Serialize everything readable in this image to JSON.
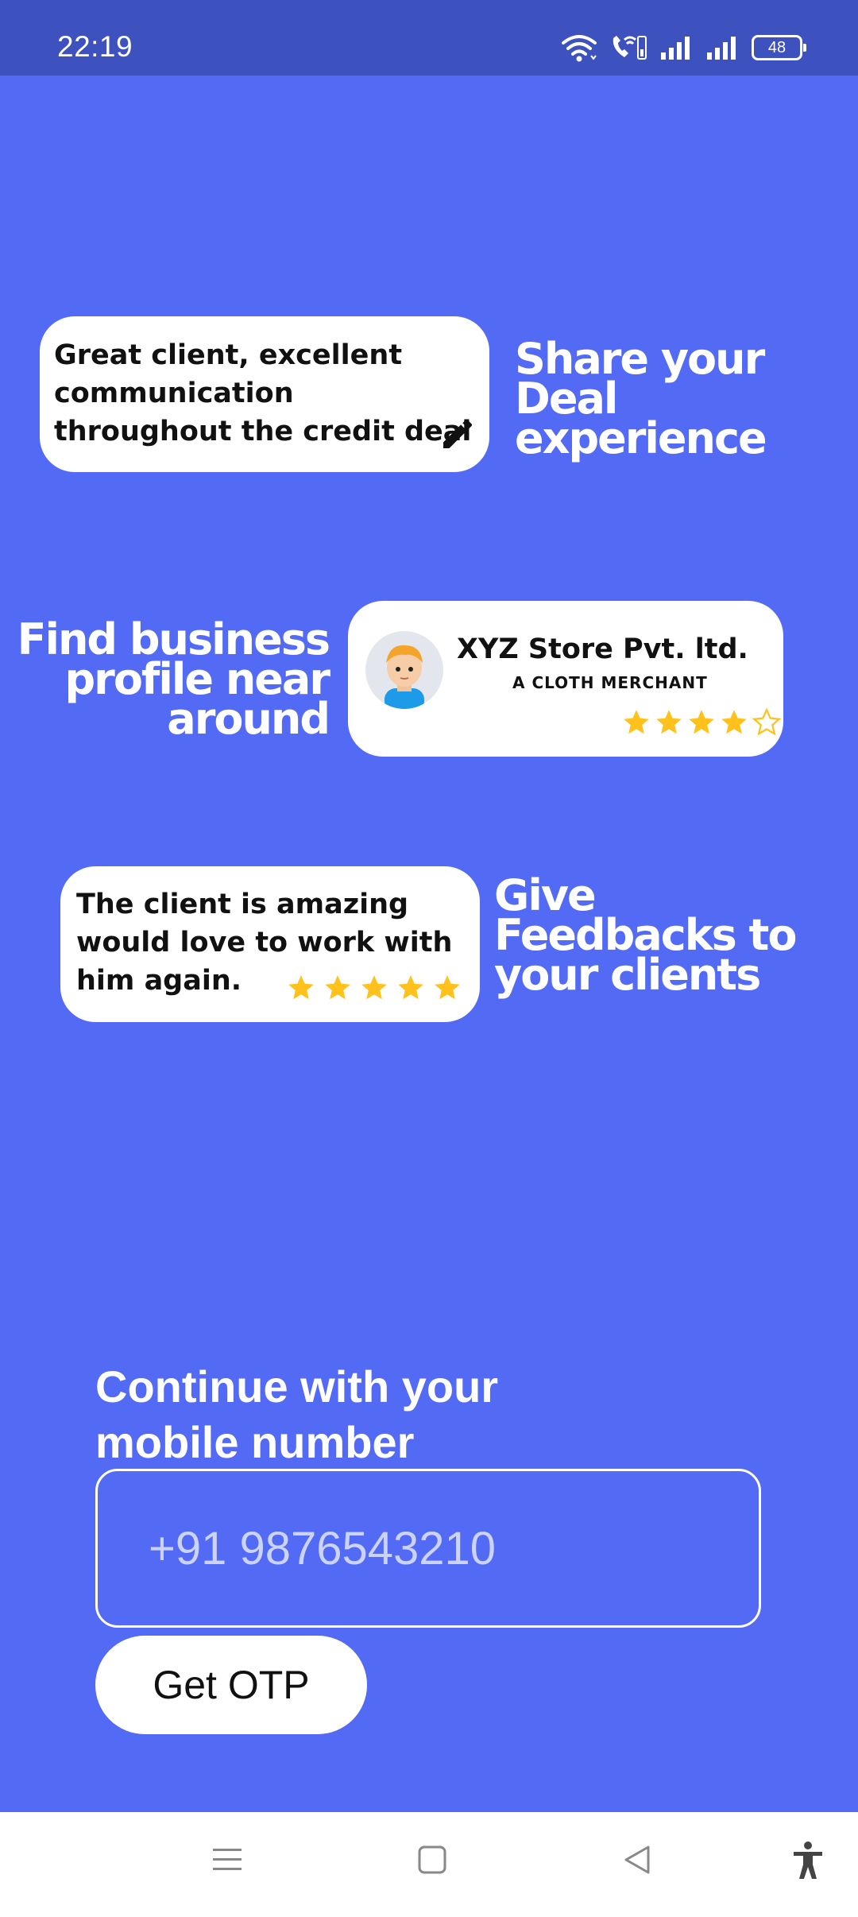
{
  "status_bar": {
    "time": "22:19",
    "battery": "48",
    "icons": [
      "wifi-icon",
      "wifi-call-icon",
      "signal-icon-1",
      "signal-icon-2",
      "battery-icon"
    ]
  },
  "cards": {
    "deal": {
      "text_lines": [
        "Great client, excellent",
        "communication",
        "throughout the credit deal"
      ],
      "icon": "pencil-icon"
    },
    "business": {
      "store_name": "XYZ Store Pvt. ltd.",
      "store_subtitle": "A CLOTH MERCHANT",
      "rating": 4,
      "rating_max": 5
    },
    "feedback": {
      "text_lines": [
        "The client is amazing",
        "would love to work with",
        "him again."
      ],
      "rating": 5,
      "rating_max": 5
    }
  },
  "headlines": {
    "share": [
      "Share your",
      "Deal",
      "experience"
    ],
    "find": [
      "Find business",
      "profile near",
      "around"
    ],
    "give": [
      "Give",
      "Feedbacks to",
      "your clients"
    ]
  },
  "login": {
    "label_lines": [
      "Continue with your",
      "mobile number"
    ],
    "phone_placeholder": "+91 9876543210",
    "phone_value": "",
    "button_label": "Get OTP"
  },
  "nav_bar": {
    "icons": [
      "menu-icon",
      "home-icon",
      "back-icon",
      "accessibility-icon"
    ]
  },
  "colors": {
    "background": "#536AF5",
    "status_bar": "#3D52BE",
    "star": "#FFC21C"
  }
}
